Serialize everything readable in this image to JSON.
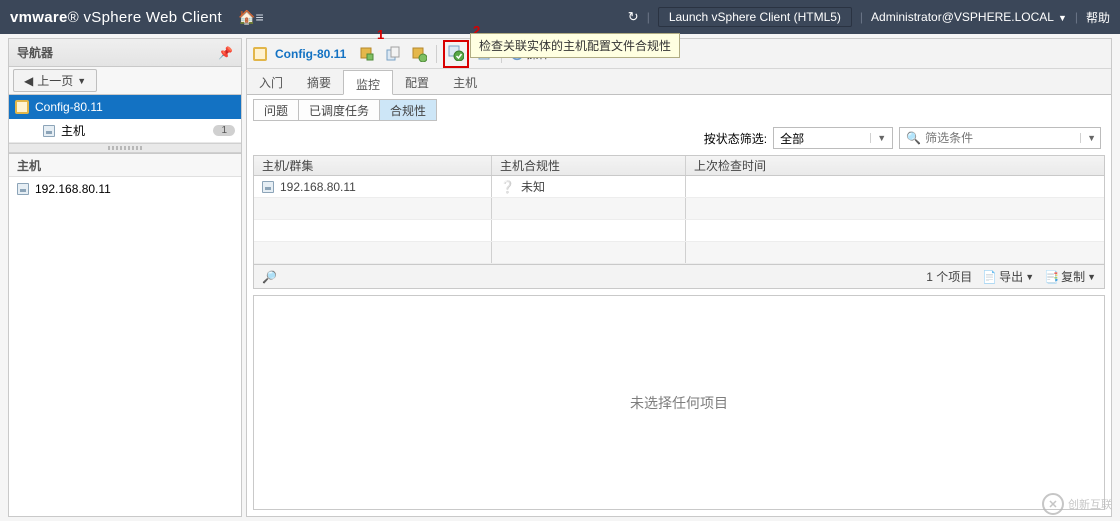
{
  "top": {
    "product": "vSphere Web Client",
    "brand": "vmware",
    "launch_label": "Launch vSphere Client (HTML5)",
    "user": "Administrator@VSPHERE.LOCAL",
    "help": "帮助"
  },
  "navigator": {
    "title": "导航器",
    "prev_label": "上一页",
    "profile_item": "Config-80.11",
    "profile_child": "主机",
    "profile_child_count": "1",
    "hosts_header": "主机",
    "host_ip": "192.168.80.11"
  },
  "toolbar": {
    "object_title": "Config-80.11",
    "actions_label": "操作",
    "tooltip_text": "检查关联实体的主机配置文件合规性",
    "annot1": "1",
    "annot2": "2"
  },
  "tabs": {
    "t1": "入门",
    "t2": "摘要",
    "t3": "监控",
    "t4": "配置",
    "t5": "主机"
  },
  "subtabs": {
    "s1": "问题",
    "s2": "已调度任务",
    "s3": "合规性"
  },
  "filter": {
    "label": "按状态筛选:",
    "value": "全部",
    "search_placeholder": "筛选条件"
  },
  "grid": {
    "col1": "主机/群集",
    "col2": "主机合规性",
    "col3": "上次检查时间",
    "row_host": "192.168.80.11",
    "row_compliance": "未知",
    "count_label": "1 个项目",
    "export_label": "导出",
    "copy_label": "复制"
  },
  "detail": {
    "empty": "未选择任何项目"
  },
  "watermark": {
    "text": "创新互联"
  }
}
